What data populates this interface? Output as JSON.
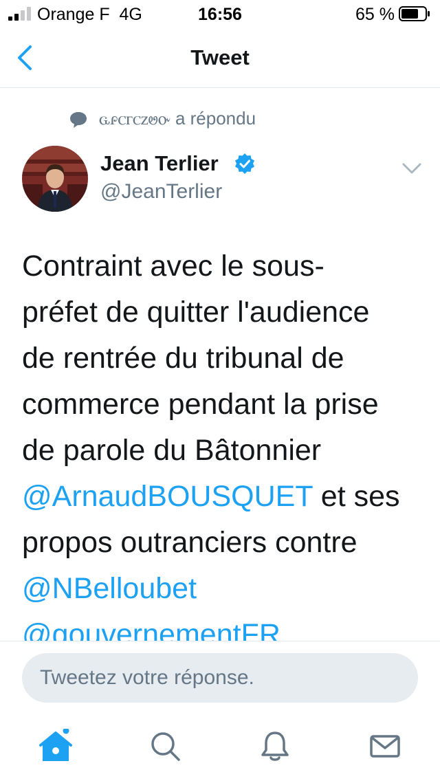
{
  "status_bar": {
    "carrier": "Orange F",
    "network": "4G",
    "time": "16:56",
    "battery": "65 %"
  },
  "nav": {
    "title": "Tweet",
    "back_icon": "chevron-left-icon"
  },
  "reply_context": {
    "icon": "speech-bubble-icon",
    "text": "ꮹꮅꮯꮁꮯꮓꮼꮕ a répondu"
  },
  "author": {
    "name": "Jean Terlier",
    "handle": "@JeanTerlier",
    "verified": true,
    "avatar_icon": "avatar-photo"
  },
  "tweet": {
    "lines": [
      [
        {
          "text": "Contraint avec le sous-",
          "mention": false
        }
      ],
      [
        {
          "text": "préfet de quitter l'audience",
          "mention": false
        }
      ],
      [
        {
          "text": "de rentrée du tribunal de",
          "mention": false
        }
      ],
      [
        {
          "text": "commerce pendant la prise",
          "mention": false
        }
      ],
      [
        {
          "text": "de parole du Bâtonnier",
          "mention": false
        }
      ],
      [
        {
          "text": "@ArnaudBOUSQUET",
          "mention": true
        },
        {
          "text": " et ses",
          "mention": false
        }
      ],
      [
        {
          "text": "propos outranciers contre",
          "mention": false
        }
      ],
      [
        {
          "text": "@NBelloubet",
          "mention": true
        }
      ],
      [
        {
          "text": "@gouvernementFR",
          "mention": true
        }
      ]
    ]
  },
  "reply_box": {
    "placeholder": "Tweetez votre réponse."
  },
  "tabs": [
    {
      "name": "tab-home",
      "icon": "home-icon",
      "active": true
    },
    {
      "name": "tab-search",
      "icon": "search-icon",
      "active": false
    },
    {
      "name": "tab-notifications",
      "icon": "bell-icon",
      "active": false
    },
    {
      "name": "tab-messages",
      "icon": "envelope-icon",
      "active": false
    }
  ],
  "colors": {
    "accent": "#1da1f2",
    "secondary_text": "#657786",
    "primary_text": "#14171a",
    "reply_box_bg": "#e6ecf0"
  }
}
